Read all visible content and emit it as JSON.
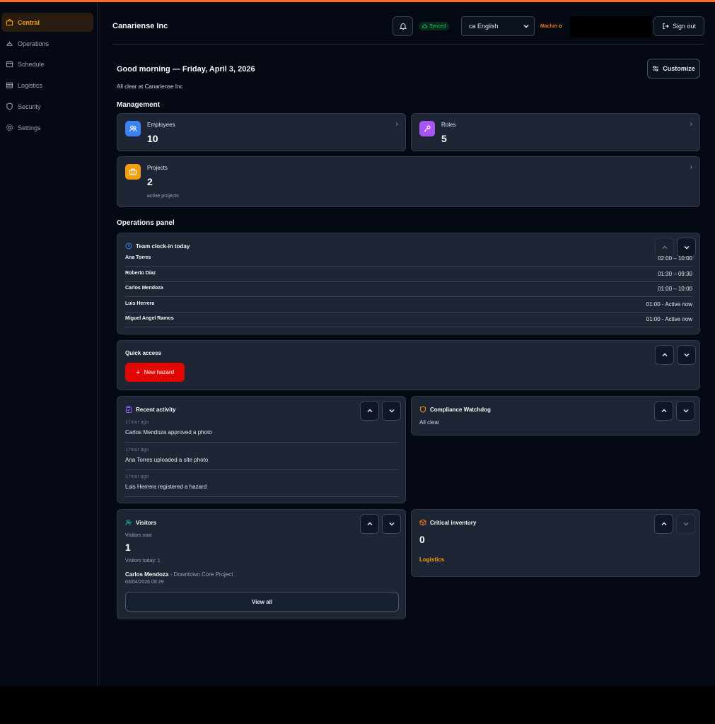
{
  "sidebar": {
    "items": [
      {
        "label": "Central",
        "icon": "home-icon"
      },
      {
        "label": "Operations",
        "icon": "hardhat-icon"
      },
      {
        "label": "Schedule",
        "icon": "calendar-icon"
      },
      {
        "label": "Logistics",
        "icon": "truck-icon"
      },
      {
        "label": "Security",
        "icon": "shield-icon"
      },
      {
        "label": "Settings",
        "icon": "gear-icon"
      }
    ],
    "active_color": "#f59e0b"
  },
  "header": {
    "company": "Canariense Inc",
    "synced": "Synced",
    "language": "ca English",
    "machine_prefix": "Machin",
    "machine_suffix": "o",
    "sign_out": "Sign out"
  },
  "greeting": {
    "title": "Good morning — Friday, April 3, 2026",
    "subtitle": "All clear at Canariense Inc",
    "customize": "Customize"
  },
  "management": {
    "title": "Management",
    "cards": [
      {
        "label": "Employees",
        "value": "10",
        "color": "#3b82f6"
      },
      {
        "label": "Roles",
        "value": "5",
        "color": "#a855f7"
      },
      {
        "label": "Projects",
        "value": "2",
        "sub": "active projects",
        "color": "#f59e0b"
      }
    ]
  },
  "operations": {
    "title": "Operations panel",
    "clockin": {
      "title": "Team clock-in today",
      "rows": [
        {
          "name": "Ana Torres",
          "time": "02:00 – 10:00"
        },
        {
          "name": "Roberto Díaz",
          "time": "01:30 – 09:30"
        },
        {
          "name": "Carlos Mendoza",
          "time": "01:00 – 10:00"
        },
        {
          "name": "Luis Herrera",
          "time": "01:00 - Active now"
        },
        {
          "name": "Miguel Angel Ramos",
          "time": "01:00 - Active now"
        }
      ]
    },
    "quick_access": {
      "title": "Quick access",
      "new_hazard": "New hazard"
    },
    "recent_activity": {
      "title": "Recent activity",
      "items": [
        {
          "ago": "1 hour ago",
          "text": "Carlos Mendoza approved a photo"
        },
        {
          "ago": "1 hour ago",
          "text": "Ana Torres uploaded a site photo"
        },
        {
          "ago": "1 hour ago",
          "text": "Luis Herrera registered a hazard"
        }
      ]
    },
    "compliance": {
      "title": "Compliance Watchdog",
      "status": "All clear"
    },
    "visitors": {
      "title": "Visitors",
      "now_label": "Visitors now",
      "now_value": "1",
      "today": "Visitors today: 1",
      "visitor_name": "Carlos Mendoza",
      "visitor_project": " - Downtown Core Project",
      "visitor_time": "03/04/2026 08:29",
      "view_all": "View all"
    },
    "inventory": {
      "title": "Critical inventory",
      "value": "0",
      "link": "Logistics"
    }
  }
}
